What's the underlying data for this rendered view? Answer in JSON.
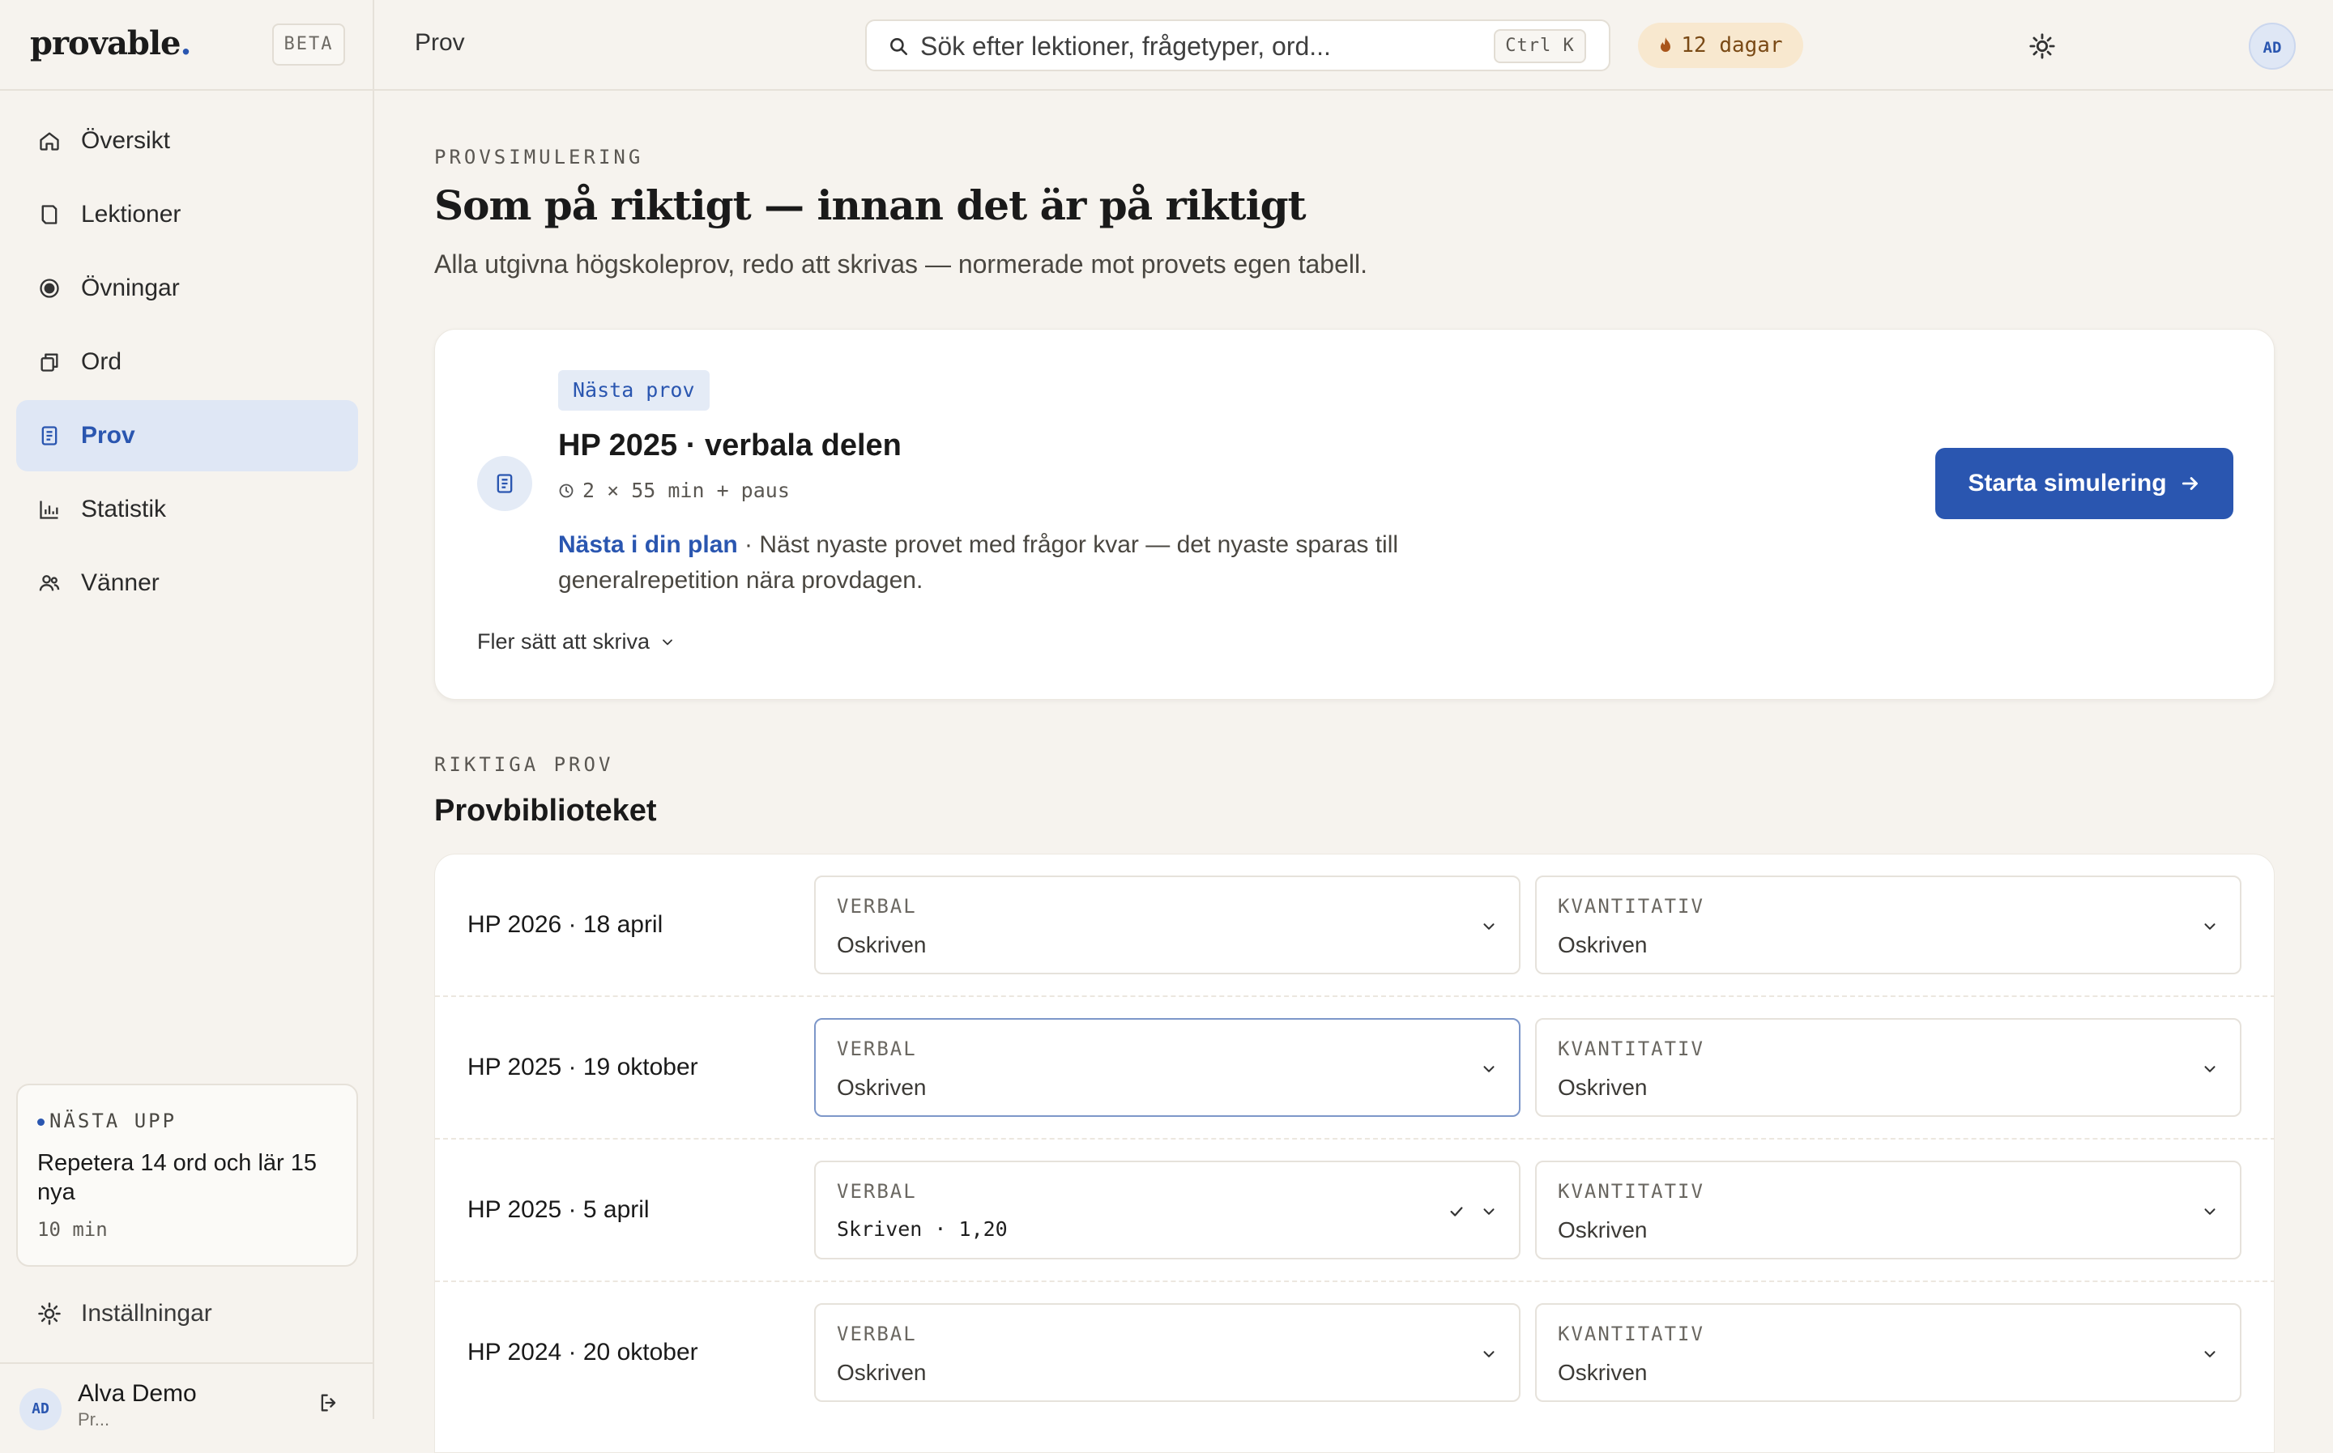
{
  "brand": {
    "name": "provable",
    "dot": ".",
    "beta": "BETA"
  },
  "sidebar": {
    "items": [
      {
        "label": "Översikt",
        "icon": "home-icon"
      },
      {
        "label": "Lektioner",
        "icon": "book-icon"
      },
      {
        "label": "Övningar",
        "icon": "target-icon"
      },
      {
        "label": "Ord",
        "icon": "cards-icon"
      },
      {
        "label": "Prov",
        "icon": "document-icon",
        "active": true
      },
      {
        "label": "Statistik",
        "icon": "bar-chart-icon"
      },
      {
        "label": "Vänner",
        "icon": "users-icon"
      }
    ],
    "next_up": {
      "tag": "NÄSTA UPP",
      "text": "Repetera 14 ord och lär 15 nya",
      "time": "10 min"
    },
    "settings": "Inställningar",
    "user": {
      "initials": "AD",
      "name": "Alva Demo",
      "sub": "Pr..."
    }
  },
  "topbar": {
    "breadcrumb": "Prov",
    "search_placeholder": "Sök efter lektioner, frågetyper, ord...",
    "shortcut": "Ctrl K",
    "streak": "12 dagar",
    "avatar": "AD"
  },
  "hero": {
    "eyebrow": "PROVSIMULERING",
    "title": "Som på riktigt — innan det är på riktigt",
    "subtitle": "Alla utgivna högskoleprov, redo att skrivas — normerade mot provets egen tabell."
  },
  "next_exam": {
    "badge": "Nästa prov",
    "title": "HP 2025 · verbala delen",
    "meta": "2 × 55 min + paus",
    "plan_link": "Nästa i din plan",
    "description": " · Näst nyaste provet med frågor kvar — det nyaste sparas till generalrepetition nära provdagen.",
    "more_ways": "Fler sätt att skriva",
    "start_button": "Starta simulering"
  },
  "library": {
    "eyebrow": "RIKTIGA PROV",
    "title": "Provbiblioteket",
    "verbal_label": "VERBAL",
    "kvant_label": "KVANTITATIV",
    "rows": [
      {
        "label": "HP 2026 · 18 april",
        "verbal": "Oskriven",
        "kvant": "Oskriven"
      },
      {
        "label": "HP 2025 · 19 oktober",
        "verbal": "Oskriven",
        "kvant": "Oskriven"
      },
      {
        "label": "HP 2025 · 5 april",
        "verbal": "Skriven · 1,20",
        "kvant": "Oskriven"
      },
      {
        "label": "HP 2024 · 20 oktober",
        "verbal": "Oskriven",
        "kvant": "Oskriven"
      }
    ]
  },
  "colors": {
    "accent": "#2a56b0",
    "background": "#f6f3ee",
    "streak_bg": "#f8e8cf"
  }
}
